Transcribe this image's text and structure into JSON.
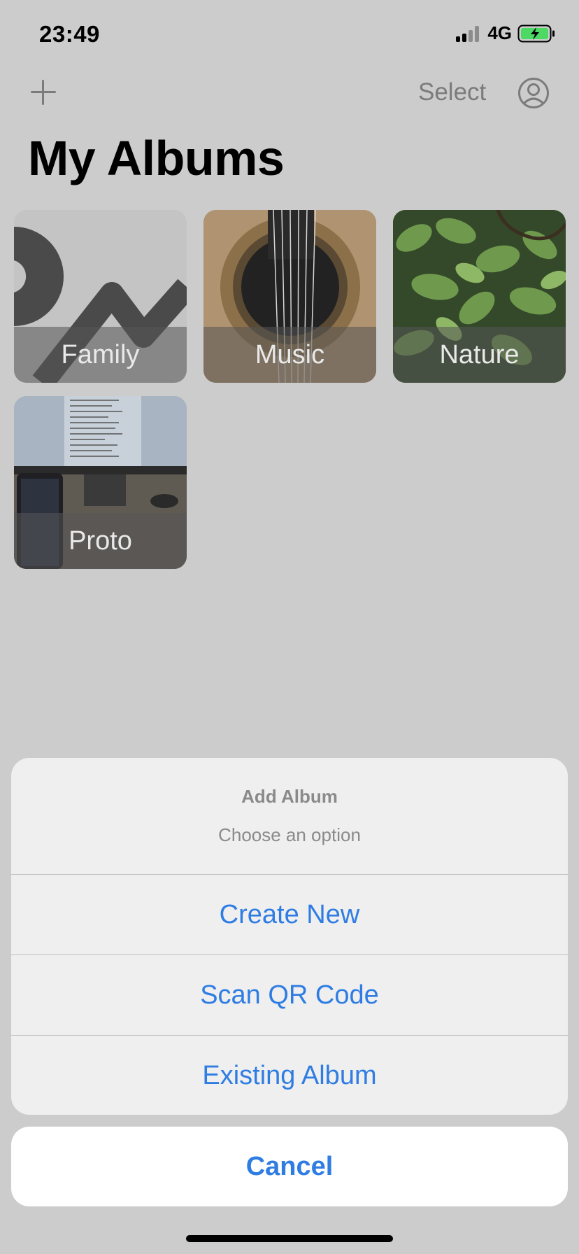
{
  "status_bar": {
    "time": "23:49",
    "network": "4G",
    "battery": "charging",
    "signal_bars_active": 2,
    "signal_bars_total": 4
  },
  "nav": {
    "add_icon": "plus-icon",
    "select_label": "Select",
    "profile_icon": "person-circle-icon"
  },
  "page": {
    "title": "My Albums"
  },
  "albums": [
    {
      "label": "Family"
    },
    {
      "label": "Music"
    },
    {
      "label": "Nature"
    },
    {
      "label": "Proto"
    }
  ],
  "action_sheet": {
    "title": "Add Album",
    "message": "Choose an option",
    "options": [
      "Create New",
      "Scan QR Code",
      "Existing Album"
    ],
    "cancel": "Cancel"
  },
  "colors": {
    "accent": "#2f7de3",
    "overlay_bg": "#cccccc",
    "battery_green": "#4cd964"
  }
}
